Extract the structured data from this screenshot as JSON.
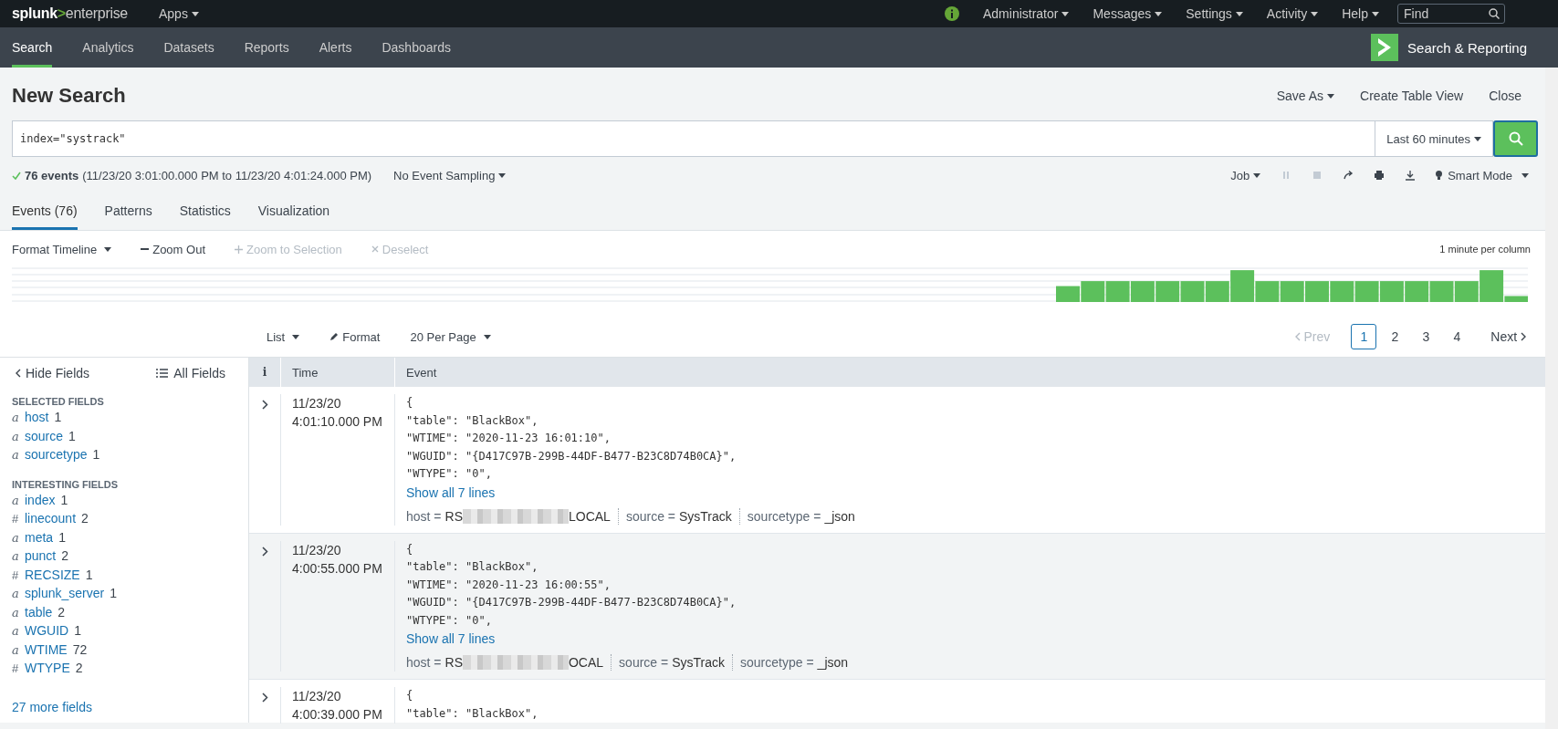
{
  "top_bar": {
    "logo": {
      "brand": "splunk",
      "mark": ">",
      "product": "enterprise"
    },
    "apps": "Apps",
    "menus": [
      "Administrator",
      "Messages",
      "Settings",
      "Activity",
      "Help"
    ],
    "find": {
      "placeholder": "Find"
    }
  },
  "nav": {
    "tabs": [
      {
        "label": "Search",
        "selected": true
      },
      {
        "label": "Analytics",
        "selected": false
      },
      {
        "label": "Datasets",
        "selected": false
      },
      {
        "label": "Reports",
        "selected": false
      },
      {
        "label": "Alerts",
        "selected": false
      },
      {
        "label": "Dashboards",
        "selected": false
      }
    ],
    "app_title": "Search & Reporting"
  },
  "header": {
    "title": "New Search",
    "actions": [
      {
        "label": "Save As",
        "dropdown": true
      },
      {
        "label": "Create Table View",
        "dropdown": false
      },
      {
        "label": "Close",
        "dropdown": false
      }
    ]
  },
  "search": {
    "query": "index=\"systrack\"",
    "time_range": "Last 60 minutes"
  },
  "status": {
    "count": "76 events",
    "range": "(11/23/20 3:01:00.000 PM to 11/23/20 4:01:24.000 PM)",
    "sampling": "No Event Sampling",
    "job": "Job",
    "mode": "Smart Mode"
  },
  "result_tabs": [
    {
      "label": "Events (76)",
      "selected": true
    },
    {
      "label": "Patterns",
      "selected": false
    },
    {
      "label": "Statistics",
      "selected": false
    },
    {
      "label": "Visualization",
      "selected": false
    }
  ],
  "timeline": {
    "tools": [
      {
        "kind": "dropdown",
        "label": "Format Timeline",
        "disabled": false
      },
      {
        "kind": "minus",
        "label": "Zoom Out",
        "disabled": false
      },
      {
        "kind": "plus",
        "label": "Zoom to Selection",
        "disabled": true
      },
      {
        "kind": "cross",
        "label": "Deselect",
        "disabled": true
      }
    ],
    "scale": "1 minute per column"
  },
  "results_toolbar": {
    "list": "List",
    "format": "Format",
    "per_page": "20 Per Page",
    "prev": {
      "label": "Prev",
      "disabled": true
    },
    "pages": [
      {
        "label": "1",
        "selected": true
      },
      {
        "label": "2",
        "selected": false
      },
      {
        "label": "3",
        "selected": false
      },
      {
        "label": "4",
        "selected": false
      }
    ],
    "next": {
      "label": "Next",
      "disabled": false
    }
  },
  "fields": {
    "hide": "Hide Fields",
    "all": "All Fields",
    "sections": [
      {
        "title": "SELECTED FIELDS",
        "items": [
          {
            "type": "a",
            "name": "host",
            "count": "1"
          },
          {
            "type": "a",
            "name": "source",
            "count": "1"
          },
          {
            "type": "a",
            "name": "sourcetype",
            "count": "1"
          }
        ]
      },
      {
        "title": "INTERESTING FIELDS",
        "items": [
          {
            "type": "a",
            "name": "index",
            "count": "1"
          },
          {
            "type": "#",
            "name": "linecount",
            "count": "2"
          },
          {
            "type": "a",
            "name": "meta",
            "count": "1"
          },
          {
            "type": "a",
            "name": "punct",
            "count": "2"
          },
          {
            "type": "#",
            "name": "RECSIZE",
            "count": "1"
          },
          {
            "type": "a",
            "name": "splunk_server",
            "count": "1"
          },
          {
            "type": "a",
            "name": "table",
            "count": "2"
          },
          {
            "type": "a",
            "name": "WGUID",
            "count": "1"
          },
          {
            "type": "a",
            "name": "WTIME",
            "count": "72"
          },
          {
            "type": "#",
            "name": "WTYPE",
            "count": "2"
          }
        ]
      }
    ],
    "more": "27 more fields"
  },
  "table": {
    "columns": [
      "i",
      "Time",
      "Event"
    ],
    "rows": [
      {
        "highlighted": false,
        "date": "11/23/20",
        "time": "4:01:10.000 PM",
        "lines": [
          "{",
          "\"table\": \"BlackBox\",",
          "\"WTIME\": \"2020-11-23 16:01:10\",",
          "\"WGUID\": \"{D417C97B-299B-44DF-B477-B23C8D74B0CA}\",",
          "\"WTYPE\": \"0\","
        ],
        "show_all": "Show all 7 lines",
        "meta": {
          "host_label": "host =",
          "host_prefix": "RS",
          "host_suffix": "LOCAL",
          "source_label": "source =",
          "source": "SysTrack",
          "sourcetype_label": "sourcetype =",
          "sourcetype": "_json"
        }
      },
      {
        "highlighted": true,
        "date": "11/23/20",
        "time": "4:00:55.000 PM",
        "lines": [
          "{",
          "\"table\": \"BlackBox\",",
          "\"WTIME\": \"2020-11-23 16:00:55\",",
          "\"WGUID\": \"{D417C97B-299B-44DF-B477-B23C8D74B0CA}\",",
          "\"WTYPE\": \"0\","
        ],
        "show_all": "Show all 7 lines",
        "meta": {
          "host_label": "host =",
          "host_prefix": "RS",
          "host_suffix": "OCAL",
          "source_label": "source =",
          "source": "SysTrack",
          "sourcetype_label": "sourcetype =",
          "sourcetype": "_json"
        }
      },
      {
        "highlighted": false,
        "date": "11/23/20",
        "time": "4:00:39.000 PM",
        "lines": [
          "{",
          "\"table\": \"BlackBox\","
        ]
      }
    ]
  }
}
